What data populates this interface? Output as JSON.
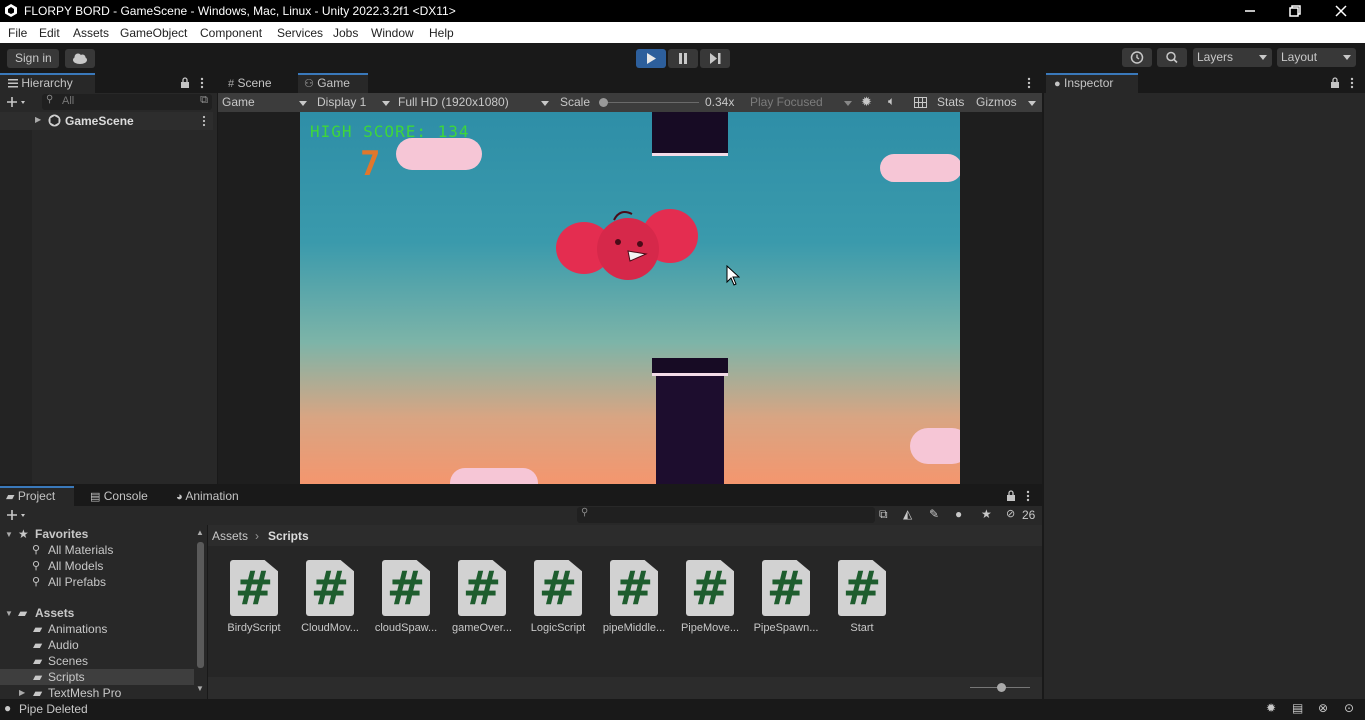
{
  "window": {
    "title": "FLORPY BORD - GameScene - Windows, Mac, Linux - Unity 2022.3.2f1 <DX11>",
    "icon": "unity-icon"
  },
  "menu": [
    "File",
    "Edit",
    "Assets",
    "GameObject",
    "Component",
    "Services",
    "Jobs",
    "Window",
    "Help"
  ],
  "toolbar": {
    "sign_in": "Sign in",
    "layers": "Layers",
    "layout": "Layout"
  },
  "hierarchy": {
    "tab": "Hierarchy",
    "search_placeholder": "All",
    "root": "GameScene"
  },
  "scene_tabs": [
    "Scene",
    "Game"
  ],
  "game_bar": {
    "view": "Game",
    "display": "Display 1",
    "resolution": "Full HD (1920x1080)",
    "scale_label": "Scale",
    "scale_value": "0.34x",
    "scale_level": 0.0,
    "play_focused": "Play Focused",
    "stats": "Stats",
    "gizmos": "Gizmos"
  },
  "game": {
    "high_score_label": "HIGH SCORE: 134",
    "score": "7"
  },
  "inspector": {
    "tab": "Inspector"
  },
  "bottom_tabs": [
    "Project",
    "Console",
    "Animation"
  ],
  "project": {
    "hidden_count": "26",
    "favorites_label": "Favorites",
    "favorites": [
      "All Materials",
      "All Models",
      "All Prefabs"
    ],
    "assets_label": "Assets",
    "folders": [
      "Animations",
      "Audio",
      "Scenes",
      "Scripts",
      "TextMesh Pro"
    ],
    "breadcrumb": [
      "Assets",
      "Scripts"
    ],
    "scripts": [
      "BirdyScript",
      "CloudMov...",
      "cloudSpaw...",
      "gameOver...",
      "LogicScript",
      "pipeMiddle...",
      "PipeMove...",
      "PipeSpawn...",
      "Start"
    ]
  },
  "status": {
    "message": "Pipe Deleted"
  },
  "colors": {
    "accent": "#3a79bb",
    "play_active": "#2d5f9c",
    "sky_top": "#2e8ea7",
    "sky_bottom": "#f5a07a",
    "bird": "#d6284a",
    "pipe": "#170b24",
    "score_text": "#3ed63a"
  }
}
